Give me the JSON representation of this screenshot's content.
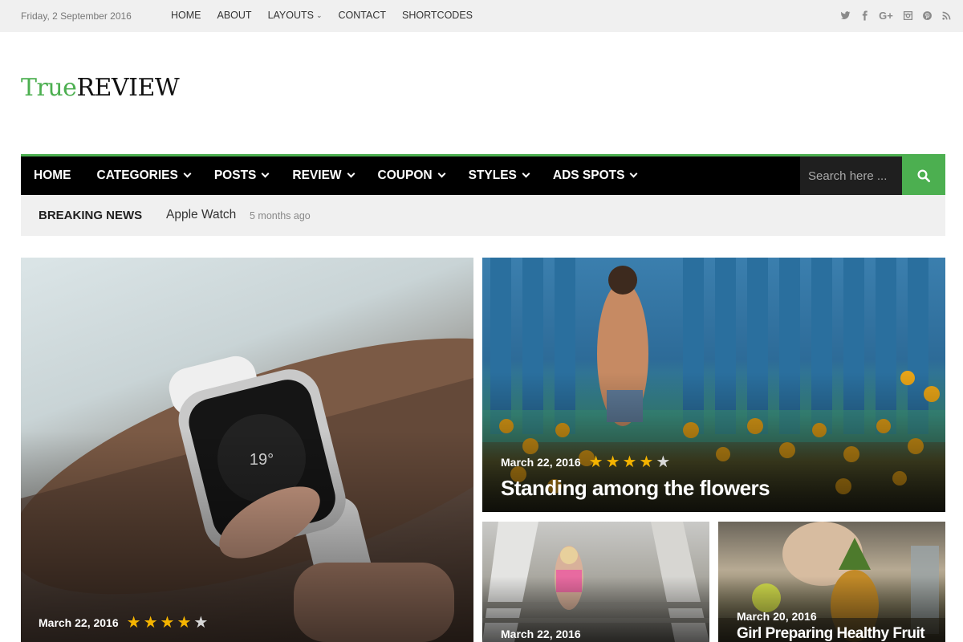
{
  "topbar": {
    "date": "Friday, 2 September 2016",
    "nav": [
      {
        "label": "HOME"
      },
      {
        "label": "ABOUT"
      },
      {
        "label": "LAYOUTS",
        "dropdown": true
      },
      {
        "label": "CONTACT"
      },
      {
        "label": "SHORTCODES"
      }
    ],
    "social_icons": [
      "twitter-icon",
      "facebook-icon",
      "google-plus-icon",
      "instagram-icon",
      "pinterest-icon",
      "rss-icon"
    ]
  },
  "logo": {
    "part1": "True",
    "part2": "REVIEW"
  },
  "mainnav": {
    "items": [
      {
        "label": "HOME",
        "dropdown": false
      },
      {
        "label": "CATEGORIES",
        "dropdown": true
      },
      {
        "label": "POSTS",
        "dropdown": true
      },
      {
        "label": "REVIEW",
        "dropdown": true
      },
      {
        "label": "COUPON",
        "dropdown": true
      },
      {
        "label": "STYLES",
        "dropdown": true
      },
      {
        "label": "ADS SPOTS",
        "dropdown": true
      }
    ],
    "search_placeholder": "Search here ...",
    "accent_color": "#4caf50"
  },
  "breaking": {
    "label": "BREAKING NEWS",
    "headline": "Apple Watch",
    "ago": "5 months ago"
  },
  "cards": [
    {
      "date": "March 22, 2016",
      "rating": 4,
      "max": 5,
      "title": ""
    },
    {
      "date": "March 22, 2016",
      "rating": 4,
      "max": 5,
      "title": "Standing among the flowers"
    },
    {
      "date": "March 22, 2016",
      "rating": 0,
      "max": 0,
      "title": ""
    },
    {
      "date": "March 20, 2016",
      "rating": 0,
      "max": 0,
      "title": "Girl Preparing Healthy Fruit"
    }
  ],
  "colors": {
    "star_on": "#f5b400",
    "star_off": "#d8d8d8",
    "brand_green": "#4caf50"
  }
}
